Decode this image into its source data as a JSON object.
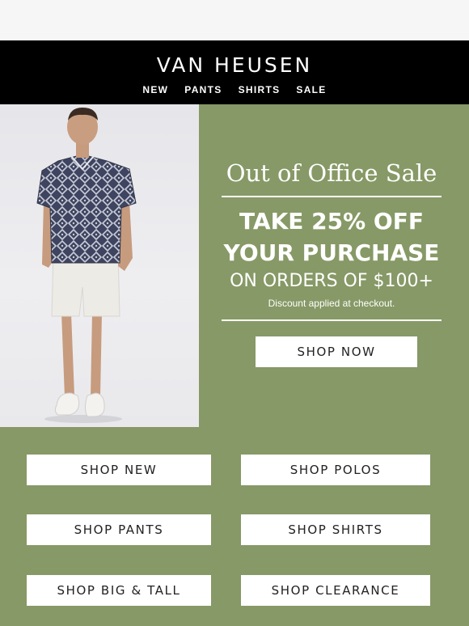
{
  "header": {
    "brand": "VAN HEUSEN",
    "nav": [
      "NEW",
      "PANTS",
      "SHIRTS",
      "SALE"
    ]
  },
  "promo": {
    "title": "Out of Office Sale",
    "line1": "TAKE 25% OFF",
    "line2": "YOUR PURCHASE",
    "line3": "ON ORDERS OF $100+",
    "note": "Discount applied at checkout.",
    "cta": "SHOP NOW"
  },
  "buttons": {
    "new": "SHOP NEW",
    "polos": "SHOP POLOS",
    "pants": "SHOP PANTS",
    "shirts": "SHOP SHIRTS",
    "big_tall": "SHOP BIG & TALL",
    "clearance": "SHOP CLEARANCE"
  },
  "colors": {
    "header_bg": "#000000",
    "accent_green": "#879966",
    "button_bg": "#ffffff"
  }
}
